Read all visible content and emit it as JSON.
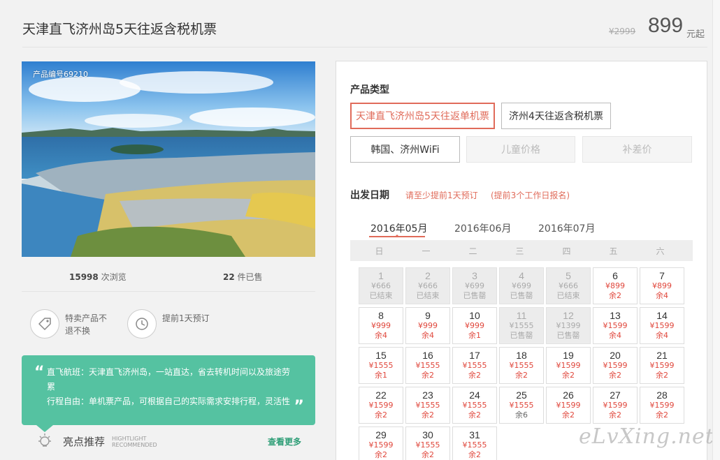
{
  "product": {
    "title": "天津直飞济州岛5天往返含税机票",
    "old_price": "¥2999",
    "price": "899",
    "price_suffix": "元起",
    "code": "产品编号69210"
  },
  "stats": {
    "views_num": "15998",
    "views_label": "次浏览",
    "sold_num": "22",
    "sold_label": "件已售"
  },
  "features": [
    {
      "icon": "tag-icon",
      "text": "特卖产品不退不换"
    },
    {
      "icon": "clock-icon",
      "text": "提前1天预订"
    }
  ],
  "highlight": {
    "line1": "直飞航班：天津直飞济州岛，一站直达，省去转机时间以及旅途劳累",
    "line2": "行程自由：单机票产品，可根据自己的实际需求安排行程，灵活性",
    "rec_title": "亮点推荐",
    "rec_sub1": "HIGHTLIGHT",
    "rec_sub2": "RECOMMENDED",
    "see_more": "查看更多"
  },
  "types": {
    "label": "产品类型",
    "options": [
      {
        "label": "天津直飞济州岛5天往返单机票",
        "state": "active"
      },
      {
        "label": "济州4天往返含税机票",
        "state": "normal"
      },
      {
        "label": "韩国、济州WiFi",
        "state": "normal"
      },
      {
        "label": "儿童价格",
        "state": "disabled"
      },
      {
        "label": "补差价",
        "state": "disabled"
      }
    ]
  },
  "dates": {
    "label": "出发日期",
    "note1": "请至少提前1天预订",
    "note2": "(提前3个工作日报名)",
    "months": [
      "2016年05月",
      "2016年06月",
      "2016年07月"
    ],
    "active_month": 0,
    "weekdays": [
      "日",
      "一",
      "二",
      "三",
      "四",
      "五",
      "六"
    ]
  },
  "calendar": [
    {
      "day": "1",
      "price": "¥666",
      "stock": "已结束",
      "state": "closed"
    },
    {
      "day": "2",
      "price": "¥666",
      "stock": "已结束",
      "state": "closed"
    },
    {
      "day": "3",
      "price": "¥699",
      "stock": "已售罄",
      "state": "closed"
    },
    {
      "day": "4",
      "price": "¥699",
      "stock": "已售罄",
      "state": "closed"
    },
    {
      "day": "5",
      "price": "¥666",
      "stock": "已结束",
      "state": "closed"
    },
    {
      "day": "6",
      "price": "¥899",
      "stock": "余2",
      "state": "open"
    },
    {
      "day": "7",
      "price": "¥899",
      "stock": "余4",
      "state": "open"
    },
    {
      "day": "8",
      "price": "¥999",
      "stock": "余4",
      "state": "open"
    },
    {
      "day": "9",
      "price": "¥999",
      "stock": "余4",
      "state": "open"
    },
    {
      "day": "10",
      "price": "¥999",
      "stock": "余1",
      "state": "open"
    },
    {
      "day": "11",
      "price": "¥1555",
      "stock": "已售罄",
      "state": "closed"
    },
    {
      "day": "12",
      "price": "¥1399",
      "stock": "已售罄",
      "state": "closed"
    },
    {
      "day": "13",
      "price": "¥1599",
      "stock": "余4",
      "state": "open"
    },
    {
      "day": "14",
      "price": "¥1599",
      "stock": "余4",
      "state": "open"
    },
    {
      "day": "15",
      "price": "¥1555",
      "stock": "余1",
      "state": "open"
    },
    {
      "day": "16",
      "price": "¥1555",
      "stock": "余2",
      "state": "open"
    },
    {
      "day": "17",
      "price": "¥1555",
      "stock": "余2",
      "state": "open"
    },
    {
      "day": "18",
      "price": "¥1555",
      "stock": "余2",
      "state": "open"
    },
    {
      "day": "19",
      "price": "¥1599",
      "stock": "余2",
      "state": "open"
    },
    {
      "day": "20",
      "price": "¥1599",
      "stock": "余2",
      "state": "open"
    },
    {
      "day": "21",
      "price": "¥1599",
      "stock": "余2",
      "state": "open"
    },
    {
      "day": "22",
      "price": "¥1599",
      "stock": "余2",
      "state": "open"
    },
    {
      "day": "23",
      "price": "¥1555",
      "stock": "余2",
      "state": "open"
    },
    {
      "day": "24",
      "price": "¥1555",
      "stock": "余2",
      "state": "open"
    },
    {
      "day": "25",
      "price": "¥1555",
      "stock": "余6",
      "state": "plain"
    },
    {
      "day": "26",
      "price": "¥1599",
      "stock": "余2",
      "state": "open"
    },
    {
      "day": "27",
      "price": "¥1599",
      "stock": "余2",
      "state": "open"
    },
    {
      "day": "28",
      "price": "¥1599",
      "stock": "余2",
      "state": "open"
    },
    {
      "day": "29",
      "price": "¥1599",
      "stock": "余2",
      "state": "open"
    },
    {
      "day": "30",
      "price": "¥1555",
      "stock": "余2",
      "state": "open"
    },
    {
      "day": "31",
      "price": "¥1555",
      "stock": "余2",
      "state": "open"
    }
  ],
  "watermark": "eLvXing.net",
  "colors": {
    "accent": "#e06b5a",
    "highlight": "#55c2a1",
    "price": "#e0473c"
  }
}
